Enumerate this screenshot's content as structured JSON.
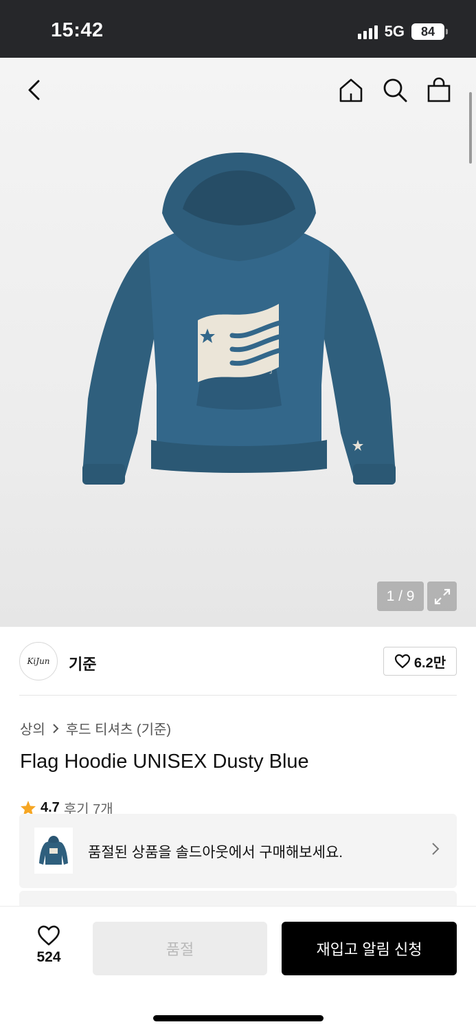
{
  "status_bar": {
    "time": "15:42",
    "network": "5G",
    "battery": "84"
  },
  "header": {
    "back_icon": "chevron-left-icon",
    "home_icon": "home-icon",
    "search_icon": "search-icon",
    "bag_icon": "shopping-bag-icon"
  },
  "gallery": {
    "counter": "1 / 9",
    "expand_icon": "expand-icon",
    "hoodie_color": "#2f5f7d"
  },
  "brand": {
    "logo_text": "KiJun",
    "name": "기준",
    "likes": "6.2만"
  },
  "breadcrumb": {
    "category": "상의",
    "subcategory": "후드 티셔츠 (기준)"
  },
  "product": {
    "title": "Flag Hoodie UNISEX Dusty Blue",
    "rating": "4.7",
    "reviews": "후기 7개"
  },
  "soldout_banner": {
    "text": "품절된 상품을 솔드아웃에서 구매해보세요."
  },
  "bottom_bar": {
    "wish_count": "524",
    "soldout_label": "품절",
    "restock_label": "재입고 알림 신청"
  },
  "colors": {
    "accent_star": "#f6a623",
    "primary_button": "#000000",
    "disabled_button": "#ececec"
  }
}
